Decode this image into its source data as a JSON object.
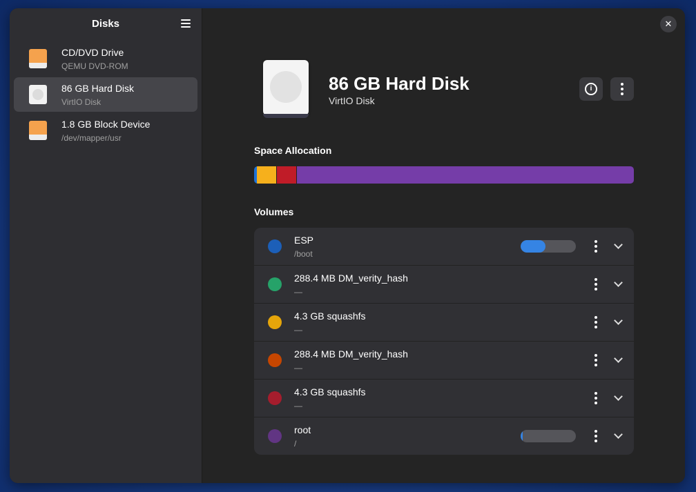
{
  "sidebar": {
    "title": "Disks",
    "items": [
      {
        "name": "CD/DVD Drive",
        "sub": "QEMU DVD-ROM",
        "icon": "optical-drive-icon"
      },
      {
        "name": "86 GB Hard Disk",
        "sub": "VirtIO Disk",
        "icon": "hard-disk-icon"
      },
      {
        "name": "1.8 GB Block Device",
        "sub": "/dev/mapper/usr",
        "icon": "block-device-icon"
      }
    ]
  },
  "main": {
    "disk_title": "86 GB Hard Disk",
    "disk_sub": "VirtIO Disk",
    "close_label": "✕",
    "space_allocation_label": "Space Allocation",
    "volumes_label": "Volumes",
    "allocation_colors": [
      "#1c71d8",
      "#f6b01c",
      "#c01c28",
      "#753da8"
    ],
    "volumes": [
      {
        "name": "ESP",
        "sub": "/boot",
        "color": "#1c5fb8",
        "usage": 0.45
      },
      {
        "name": "288.4 MB DM_verity_hash",
        "sub": "—",
        "color": "#26a269"
      },
      {
        "name": "4.3 GB squashfs",
        "sub": "—",
        "color": "#e5a50a"
      },
      {
        "name": "288.4 MB DM_verity_hash",
        "sub": "—",
        "color": "#c64600"
      },
      {
        "name": "4.3 GB squashfs",
        "sub": "—",
        "color": "#a51d2d"
      },
      {
        "name": "root",
        "sub": "/",
        "color": "#613583",
        "usage": 0.02
      }
    ]
  }
}
